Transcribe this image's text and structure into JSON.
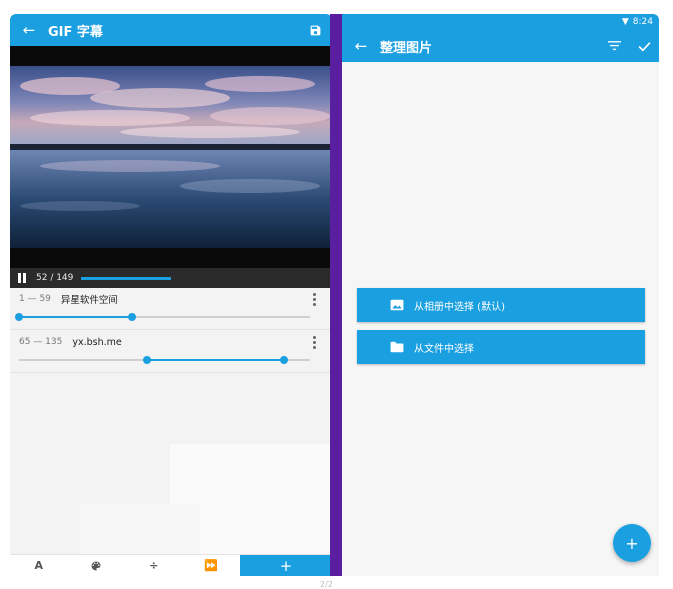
{
  "left_app": {
    "title": "GIF 字幕",
    "back_icon": "arrow-left-icon",
    "save_icon": "floppy-save-icon",
    "player": {
      "frame_counter": "52 / 149",
      "progress": 0.35
    },
    "captions": [
      {
        "range": "1 — 59",
        "text": "异星软件空间",
        "start": 0.0,
        "end": 0.39
      },
      {
        "range": "65 — 135",
        "text": "yx.bsh.me",
        "start": 0.44,
        "end": 0.91
      }
    ],
    "toolbar": {
      "text_label": "A",
      "palette_icon": "palette-icon",
      "divide_icon": "divide-icon",
      "speed_icon": "fast-forward-icon",
      "add_label": "+"
    }
  },
  "right_app": {
    "status_time": "8:24",
    "title": "整理图片",
    "filter_icon": "filter-icon",
    "confirm_icon": "check-icon",
    "buttons": [
      {
        "label": "从相册中选择 (默认)",
        "icon": "image-icon"
      },
      {
        "label": "从文件中选择",
        "icon": "folder-icon"
      }
    ],
    "fab_label": "+"
  },
  "colors": {
    "primary": "#1a9fe0",
    "purple_divider": "#5a1ea0",
    "background": "#f6f6f6"
  },
  "pager": "2/2"
}
